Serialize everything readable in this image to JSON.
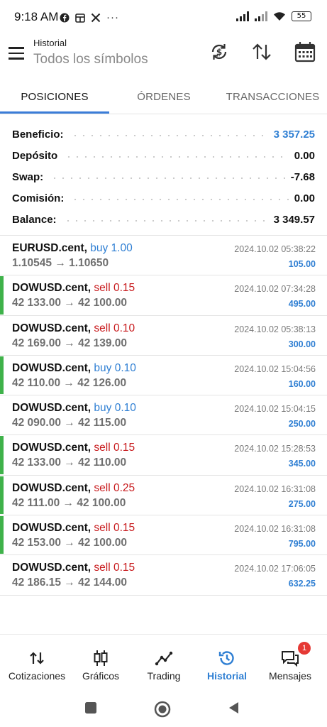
{
  "status_bar": {
    "time": "9:18 AM",
    "battery": "55",
    "icons": [
      "facebook-icon",
      "calendar-box-icon",
      "x-icon",
      "more-dots-icon",
      "signal-icon",
      "signal-icon",
      "wifi-icon",
      "battery-icon"
    ],
    "more": "···"
  },
  "header": {
    "title": "Historial",
    "subtitle": "Todos los símbolos"
  },
  "tabs": [
    {
      "label": "POSICIONES",
      "active": true
    },
    {
      "label": "ÓRDENES",
      "active": false
    },
    {
      "label": "TRANSACCIONES",
      "active": false
    }
  ],
  "summary": [
    {
      "label": "Beneficio:",
      "value": "3 357.25",
      "highlight": true
    },
    {
      "label": "Depósito",
      "value": "0.00",
      "highlight": false
    },
    {
      "label": "Swap:",
      "value": "-7.68",
      "highlight": false
    },
    {
      "label": "Comisión:",
      "value": "0.00",
      "highlight": false
    },
    {
      "label": "Balance:",
      "value": "3 349.57",
      "highlight": false
    }
  ],
  "trades": [
    {
      "symbol": "EURUSD.cent,",
      "side": "buy 1.00",
      "prices": "1.10545 → 1.10650",
      "time": "2024.10.02 05:38:22",
      "profit": "105.00",
      "marked": false
    },
    {
      "symbol": "DOWUSD.cent,",
      "side": "sell 0.15",
      "prices": "42 133.00 → 42 100.00",
      "time": "2024.10.02 07:34:28",
      "profit": "495.00",
      "marked": true
    },
    {
      "symbol": "DOWUSD.cent,",
      "side": "sell 0.10",
      "prices": "42 169.00 → 42 139.00",
      "time": "2024.10.02 05:38:13",
      "profit": "300.00",
      "marked": false
    },
    {
      "symbol": "DOWUSD.cent,",
      "side": "buy 0.10",
      "prices": "42 110.00 → 42 126.00",
      "time": "2024.10.02 15:04:56",
      "profit": "160.00",
      "marked": true
    },
    {
      "symbol": "DOWUSD.cent,",
      "side": "buy 0.10",
      "prices": "42 090.00 → 42 115.00",
      "time": "2024.10.02 15:04:15",
      "profit": "250.00",
      "marked": false
    },
    {
      "symbol": "DOWUSD.cent,",
      "side": "sell 0.15",
      "prices": "42 133.00 → 42 110.00",
      "time": "2024.10.02 15:28:53",
      "profit": "345.00",
      "marked": true
    },
    {
      "symbol": "DOWUSD.cent,",
      "side": "sell 0.25",
      "prices": "42 111.00 → 42 100.00",
      "time": "2024.10.02 16:31:08",
      "profit": "275.00",
      "marked": true
    },
    {
      "symbol": "DOWUSD.cent,",
      "side": "sell 0.15",
      "prices": "42 153.00 → 42 100.00",
      "time": "2024.10.02 16:31:08",
      "profit": "795.00",
      "marked": true
    },
    {
      "symbol": "DOWUSD.cent,",
      "side": "sell 0.15",
      "prices": "42 186.15 → 42 144.00",
      "time": "2024.10.02 17:06:05",
      "profit": "632.25",
      "marked": false
    }
  ],
  "bottom_nav": [
    {
      "label": "Cotizaciones",
      "icon": "quotes-arrows-icon",
      "active": false
    },
    {
      "label": "Gráficos",
      "icon": "candlestick-chart-icon",
      "active": false
    },
    {
      "label": "Trading",
      "icon": "trading-line-icon",
      "active": false
    },
    {
      "label": "Historial",
      "icon": "history-clock-icon",
      "active": true
    },
    {
      "label": "Mensajes",
      "icon": "messages-icon",
      "active": false,
      "badge": "1"
    }
  ],
  "colors": {
    "accent": "#2f7fd3",
    "sell": "#c8191c",
    "marker": "#3fb24a",
    "badge": "#e53935"
  }
}
